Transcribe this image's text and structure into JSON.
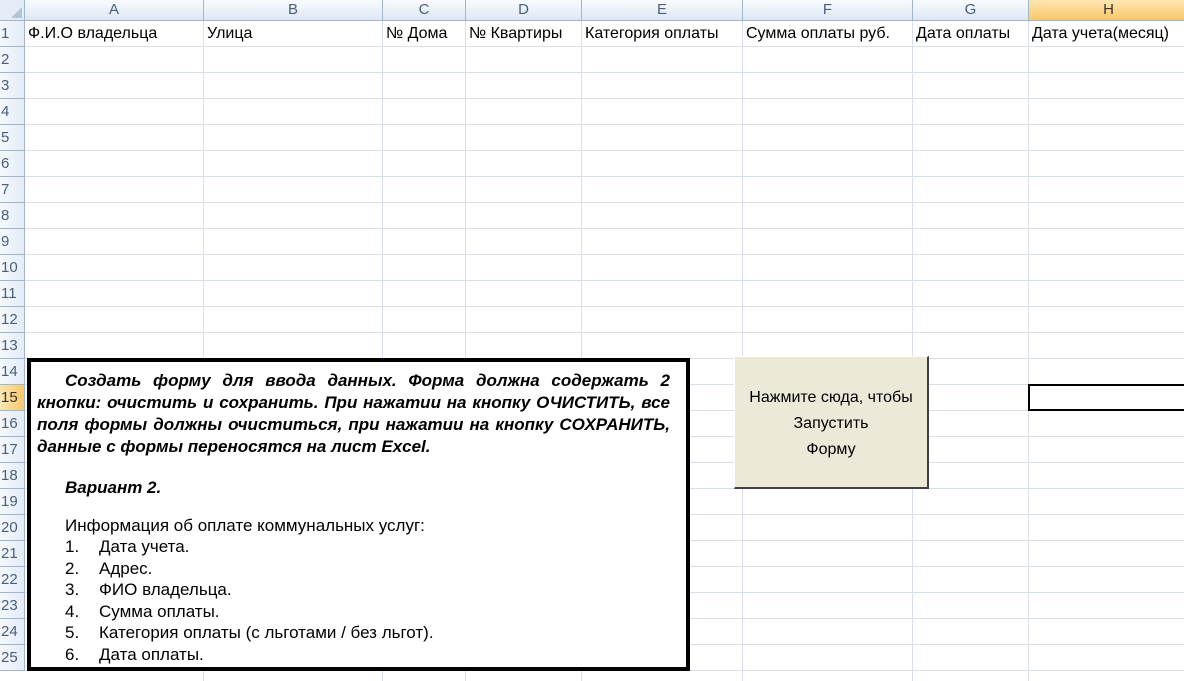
{
  "columns": [
    "A",
    "B",
    "C",
    "D",
    "E",
    "F",
    "G",
    "H"
  ],
  "active_column": "H",
  "rows": [
    "1",
    "2",
    "3",
    "4",
    "5",
    "6",
    "7",
    "8",
    "9",
    "10",
    "11",
    "12",
    "13",
    "14",
    "15",
    "16",
    "17",
    "18",
    "19",
    "20",
    "21",
    "22",
    "23",
    "24",
    "25"
  ],
  "active_row": "15",
  "header_row": [
    "Ф.И.О владельца",
    "Улица",
    "№ Дома",
    "№ Квартиры",
    "Категория оплаты",
    "Сумма оплаты руб.",
    "Дата оплаты",
    "Дата учета(месяц)"
  ],
  "task": {
    "intro": "Создать форму для ввода данных. Форма должна содержать 2 кнопки: очистить и сохранить. При нажатии на кнопку ОЧИСТИТЬ, все поля формы должны очиститься, при нажатии на кнопку СОХРАНИТЬ, данные с формы переносятся на лист Excel.",
    "variant": "Вариант 2.",
    "info_title": "Информация об оплате коммунальных услуг:",
    "items": [
      {
        "num": "1.",
        "text": "Дата учета."
      },
      {
        "num": "2.",
        "text": "Адрес."
      },
      {
        "num": "3.",
        "text": "ФИО владельца."
      },
      {
        "num": "4.",
        "text": "Сумма оплаты."
      },
      {
        "num": "5.",
        "text": "Категория оплаты (с льготами / без льгот)."
      },
      {
        "num": "6.",
        "text": "Дата оплаты."
      }
    ]
  },
  "launch_button": {
    "line1": "Нажмите сюда, чтобы",
    "line2": "Запустить",
    "line3": "Форму"
  }
}
